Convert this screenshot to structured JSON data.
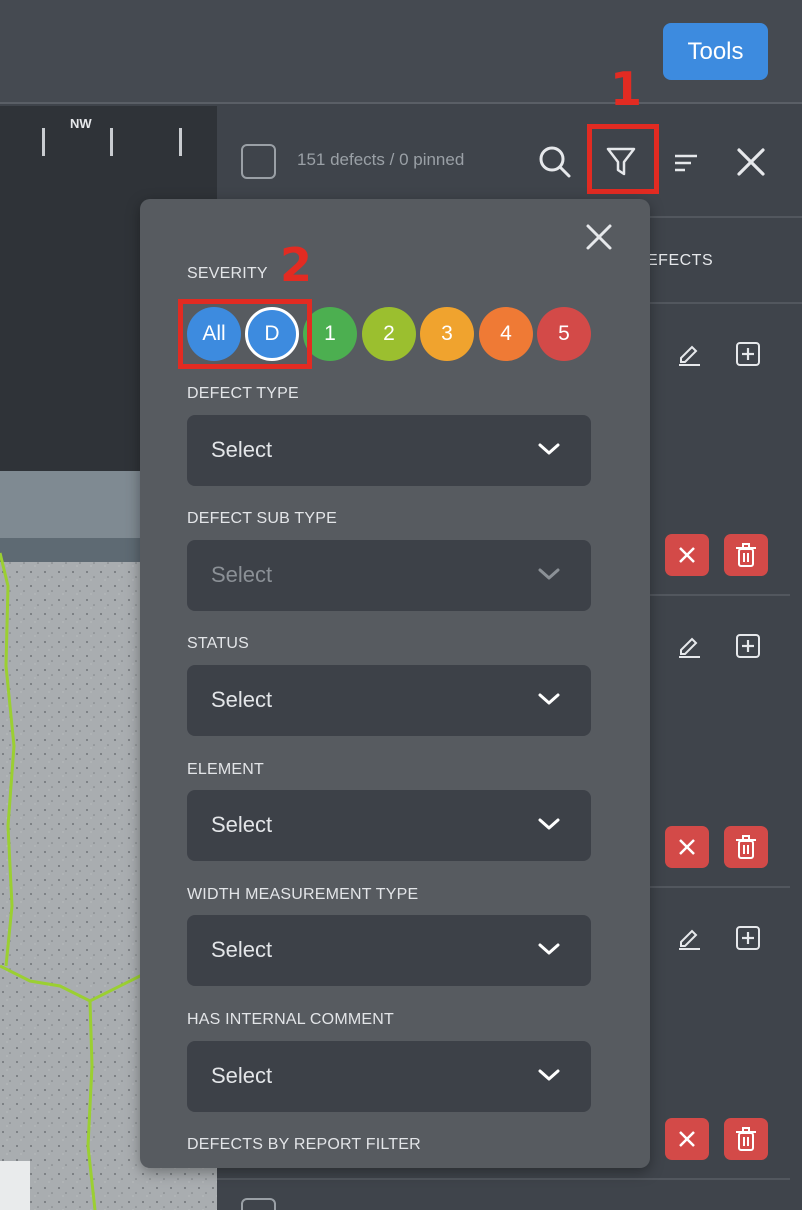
{
  "toolbar": {
    "tools_label": "Tools"
  },
  "map": {
    "compass_label": "NW"
  },
  "panel": {
    "count_text": "151 defects / 0 pinned",
    "tab_label": "EFECTS"
  },
  "annotations": {
    "step1": "1",
    "step2": "2"
  },
  "filter": {
    "severity_label": "SEVERITY",
    "severity_chips": [
      {
        "label": "All",
        "color": "#3d8bdf"
      },
      {
        "label": "D",
        "color": "#3d8bdf"
      },
      {
        "label": "1",
        "color": "#4caf50"
      },
      {
        "label": "2",
        "color": "#9bbf2f"
      },
      {
        "label": "3",
        "color": "#f0a32e"
      },
      {
        "label": "4",
        "color": "#ef7a35"
      },
      {
        "label": "5",
        "color": "#d34a48"
      }
    ],
    "defect_type": {
      "label": "DEFECT TYPE",
      "value": "Select"
    },
    "defect_sub_type": {
      "label": "DEFECT SUB TYPE",
      "value": "Select"
    },
    "status": {
      "label": "STATUS",
      "value": "Select"
    },
    "element": {
      "label": "ELEMENT",
      "value": "Select"
    },
    "width_measurement_type": {
      "label": "WIDTH MEASUREMENT TYPE",
      "value": "Select"
    },
    "has_internal_comment": {
      "label": "HAS INTERNAL COMMENT",
      "value": "Select"
    },
    "defects_by_report_filter": {
      "label": "DEFECTS BY REPORT FILTER"
    }
  }
}
